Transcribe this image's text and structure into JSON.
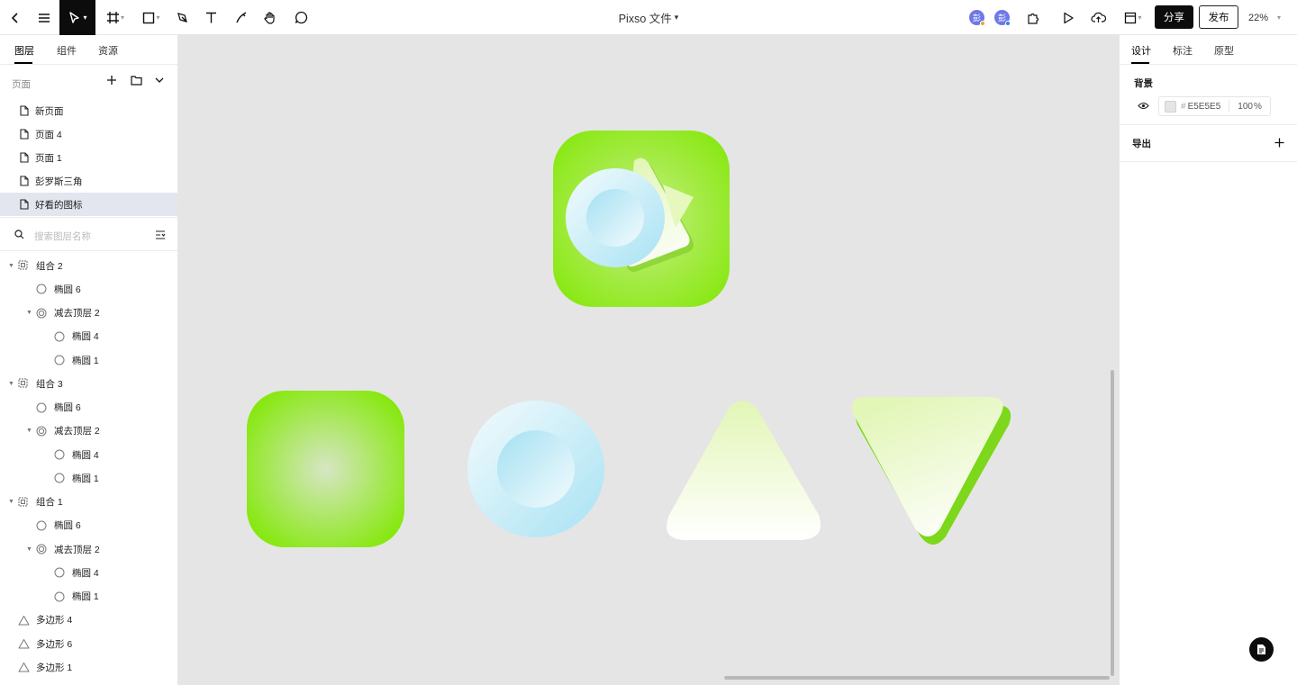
{
  "app": {
    "file_title": "Pixso 文件",
    "zoom": "22%"
  },
  "toolbar": {
    "share_label": "分享",
    "publish_label": "发布",
    "avatars": [
      {
        "initial": "彭",
        "dot_color": "#f5a623"
      },
      {
        "initial": "彭",
        "dot_color": "#2f80ed"
      }
    ]
  },
  "left_panel": {
    "tabs": [
      {
        "label": "图层"
      },
      {
        "label": "组件"
      },
      {
        "label": "资源"
      }
    ],
    "pages_label": "页面",
    "pages": [
      {
        "label": "新页面"
      },
      {
        "label": "页面 4"
      },
      {
        "label": "页面 1"
      },
      {
        "label": "彭罗斯三角"
      },
      {
        "label": "好看的图标"
      }
    ],
    "search_placeholder": "搜索图层名称",
    "layers": [
      {
        "label": "组合 2",
        "type": "group"
      },
      {
        "label": "椭圆 6",
        "type": "ellipse"
      },
      {
        "label": "减去顶层 2",
        "type": "subtract"
      },
      {
        "label": "椭圆 4",
        "type": "ellipse"
      },
      {
        "label": "椭圆 1",
        "type": "ellipse"
      },
      {
        "label": "组合 3",
        "type": "group"
      },
      {
        "label": "椭圆 6",
        "type": "ellipse"
      },
      {
        "label": "减去顶层 2",
        "type": "subtract"
      },
      {
        "label": "椭圆 4",
        "type": "ellipse"
      },
      {
        "label": "椭圆 1",
        "type": "ellipse"
      },
      {
        "label": "组合 1",
        "type": "group"
      },
      {
        "label": "椭圆 6",
        "type": "ellipse"
      },
      {
        "label": "减去顶层 2",
        "type": "subtract"
      },
      {
        "label": "椭圆 4",
        "type": "ellipse"
      },
      {
        "label": "椭圆 1",
        "type": "ellipse"
      },
      {
        "label": "多边形 4",
        "type": "polygon"
      },
      {
        "label": "多边形 6",
        "type": "polygon"
      },
      {
        "label": "多边形 1",
        "type": "polygon"
      }
    ]
  },
  "right_panel": {
    "tabs": [
      {
        "label": "设计"
      },
      {
        "label": "标注"
      },
      {
        "label": "原型"
      }
    ],
    "background_label": "背景",
    "background_hex": "E5E5E5",
    "background_opacity": "100",
    "opacity_unit": "%",
    "hex_prefix": "#",
    "export_label": "导出"
  },
  "colors": {
    "canvas_bg": "#E5E5E5",
    "green": "#8ee61a",
    "light_blue": "#b2e6f5",
    "pale_lime": "#e8f8c4",
    "selected_page": "#e3e6ee"
  }
}
